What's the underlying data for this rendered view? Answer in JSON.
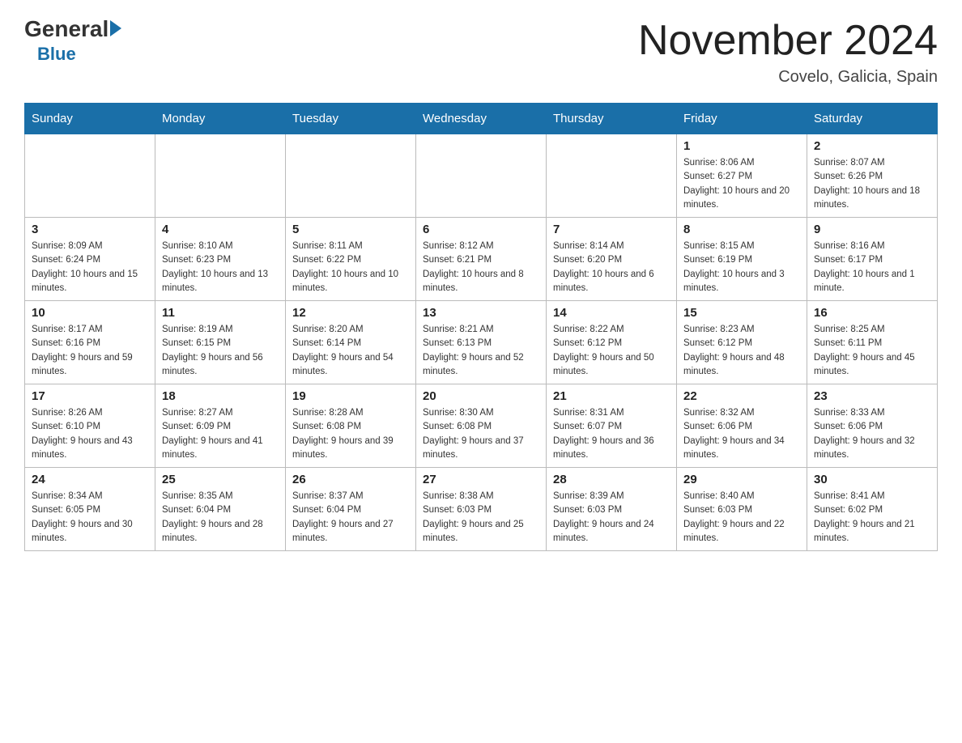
{
  "logo": {
    "general": "General",
    "arrow": "",
    "blue": "Blue"
  },
  "title": "November 2024",
  "location": "Covelo, Galicia, Spain",
  "days_of_week": [
    "Sunday",
    "Monday",
    "Tuesday",
    "Wednesday",
    "Thursday",
    "Friday",
    "Saturday"
  ],
  "weeks": [
    [
      {
        "day": "",
        "info": ""
      },
      {
        "day": "",
        "info": ""
      },
      {
        "day": "",
        "info": ""
      },
      {
        "day": "",
        "info": ""
      },
      {
        "day": "",
        "info": ""
      },
      {
        "day": "1",
        "info": "Sunrise: 8:06 AM\nSunset: 6:27 PM\nDaylight: 10 hours and 20 minutes."
      },
      {
        "day": "2",
        "info": "Sunrise: 8:07 AM\nSunset: 6:26 PM\nDaylight: 10 hours and 18 minutes."
      }
    ],
    [
      {
        "day": "3",
        "info": "Sunrise: 8:09 AM\nSunset: 6:24 PM\nDaylight: 10 hours and 15 minutes."
      },
      {
        "day": "4",
        "info": "Sunrise: 8:10 AM\nSunset: 6:23 PM\nDaylight: 10 hours and 13 minutes."
      },
      {
        "day": "5",
        "info": "Sunrise: 8:11 AM\nSunset: 6:22 PM\nDaylight: 10 hours and 10 minutes."
      },
      {
        "day": "6",
        "info": "Sunrise: 8:12 AM\nSunset: 6:21 PM\nDaylight: 10 hours and 8 minutes."
      },
      {
        "day": "7",
        "info": "Sunrise: 8:14 AM\nSunset: 6:20 PM\nDaylight: 10 hours and 6 minutes."
      },
      {
        "day": "8",
        "info": "Sunrise: 8:15 AM\nSunset: 6:19 PM\nDaylight: 10 hours and 3 minutes."
      },
      {
        "day": "9",
        "info": "Sunrise: 8:16 AM\nSunset: 6:17 PM\nDaylight: 10 hours and 1 minute."
      }
    ],
    [
      {
        "day": "10",
        "info": "Sunrise: 8:17 AM\nSunset: 6:16 PM\nDaylight: 9 hours and 59 minutes."
      },
      {
        "day": "11",
        "info": "Sunrise: 8:19 AM\nSunset: 6:15 PM\nDaylight: 9 hours and 56 minutes."
      },
      {
        "day": "12",
        "info": "Sunrise: 8:20 AM\nSunset: 6:14 PM\nDaylight: 9 hours and 54 minutes."
      },
      {
        "day": "13",
        "info": "Sunrise: 8:21 AM\nSunset: 6:13 PM\nDaylight: 9 hours and 52 minutes."
      },
      {
        "day": "14",
        "info": "Sunrise: 8:22 AM\nSunset: 6:12 PM\nDaylight: 9 hours and 50 minutes."
      },
      {
        "day": "15",
        "info": "Sunrise: 8:23 AM\nSunset: 6:12 PM\nDaylight: 9 hours and 48 minutes."
      },
      {
        "day": "16",
        "info": "Sunrise: 8:25 AM\nSunset: 6:11 PM\nDaylight: 9 hours and 45 minutes."
      }
    ],
    [
      {
        "day": "17",
        "info": "Sunrise: 8:26 AM\nSunset: 6:10 PM\nDaylight: 9 hours and 43 minutes."
      },
      {
        "day": "18",
        "info": "Sunrise: 8:27 AM\nSunset: 6:09 PM\nDaylight: 9 hours and 41 minutes."
      },
      {
        "day": "19",
        "info": "Sunrise: 8:28 AM\nSunset: 6:08 PM\nDaylight: 9 hours and 39 minutes."
      },
      {
        "day": "20",
        "info": "Sunrise: 8:30 AM\nSunset: 6:08 PM\nDaylight: 9 hours and 37 minutes."
      },
      {
        "day": "21",
        "info": "Sunrise: 8:31 AM\nSunset: 6:07 PM\nDaylight: 9 hours and 36 minutes."
      },
      {
        "day": "22",
        "info": "Sunrise: 8:32 AM\nSunset: 6:06 PM\nDaylight: 9 hours and 34 minutes."
      },
      {
        "day": "23",
        "info": "Sunrise: 8:33 AM\nSunset: 6:06 PM\nDaylight: 9 hours and 32 minutes."
      }
    ],
    [
      {
        "day": "24",
        "info": "Sunrise: 8:34 AM\nSunset: 6:05 PM\nDaylight: 9 hours and 30 minutes."
      },
      {
        "day": "25",
        "info": "Sunrise: 8:35 AM\nSunset: 6:04 PM\nDaylight: 9 hours and 28 minutes."
      },
      {
        "day": "26",
        "info": "Sunrise: 8:37 AM\nSunset: 6:04 PM\nDaylight: 9 hours and 27 minutes."
      },
      {
        "day": "27",
        "info": "Sunrise: 8:38 AM\nSunset: 6:03 PM\nDaylight: 9 hours and 25 minutes."
      },
      {
        "day": "28",
        "info": "Sunrise: 8:39 AM\nSunset: 6:03 PM\nDaylight: 9 hours and 24 minutes."
      },
      {
        "day": "29",
        "info": "Sunrise: 8:40 AM\nSunset: 6:03 PM\nDaylight: 9 hours and 22 minutes."
      },
      {
        "day": "30",
        "info": "Sunrise: 8:41 AM\nSunset: 6:02 PM\nDaylight: 9 hours and 21 minutes."
      }
    ]
  ]
}
